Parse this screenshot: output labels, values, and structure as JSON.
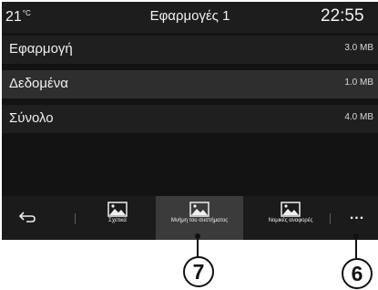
{
  "status": {
    "temperature": "21",
    "temperature_unit": "°C",
    "title": "Εφαρμογές 1",
    "time": "22:55"
  },
  "rows": [
    {
      "label": "Εφαρμογή",
      "value": "3.0 MB"
    },
    {
      "label": "Δεδομένα",
      "value": "1.0 MB"
    },
    {
      "label": "Σύνολο",
      "value": "4.0 MB"
    }
  ],
  "toolbar": {
    "back_icon": "back-arrow-icon",
    "tabs": [
      {
        "label": "Σχετικά",
        "icon": "image-icon",
        "active": false
      },
      {
        "label": "Μνήμη του συστήματος",
        "icon": "image-icon",
        "active": true
      },
      {
        "label": "Νομικές αναφορές",
        "icon": "image-icon",
        "active": false
      }
    ],
    "more_label": "..."
  },
  "callouts": {
    "left": "7",
    "right": "6"
  },
  "colors": {
    "screen_bg": "#131313",
    "active_tab_bg": "#3b3b3b",
    "text": "#f0f0f0"
  }
}
